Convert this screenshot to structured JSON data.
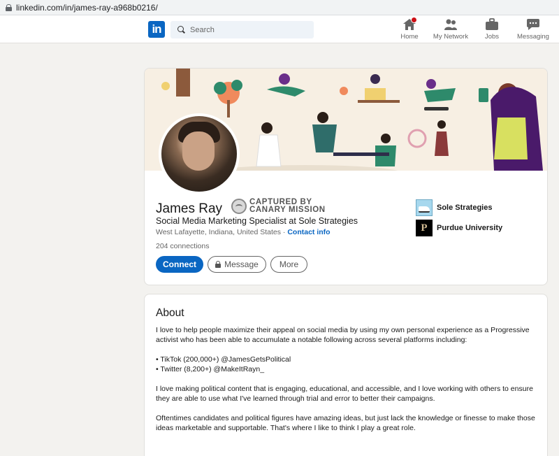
{
  "browser": {
    "url": "linkedin.com/in/james-ray-a968b0216/"
  },
  "nav": {
    "logo": "in",
    "search_placeholder": "Search",
    "items": [
      {
        "label": "Home",
        "icon": "home-icon"
      },
      {
        "label": "My Network",
        "icon": "network-icon"
      },
      {
        "label": "Jobs",
        "icon": "briefcase-icon"
      },
      {
        "label": "Messaging",
        "icon": "messaging-icon"
      }
    ]
  },
  "profile": {
    "name": "James Ray",
    "capture_line1": "CAPTURED BY",
    "capture_line2": "CANARY MISSION",
    "headline": "Social Media Marketing Specialist at Sole Strategies",
    "location": "West Lafayette, Indiana, United States",
    "separator": "·",
    "contact_info": "Contact info",
    "connections": "204 connections",
    "buttons": {
      "connect": "Connect",
      "message": "Message",
      "more": "More"
    },
    "companies": [
      {
        "name": "Sole Strategies"
      },
      {
        "name": "Purdue University"
      }
    ]
  },
  "about": {
    "title": "About",
    "p1": "I love to help people maximize their appeal on social media by using my own personal experience as a Progressive activist who has been able to accumulate a notable following across several platforms including:",
    "bullet1": "• TikTok (200,000+) @JamesGetsPolitical",
    "bullet2": "• Twitter (8,200+) @MakeItRayn_",
    "p2": "I love making political content that is engaging, educational, and accessible, and I love working with others to ensure they are able to use what I've learned through trial and error to better their campaigns.",
    "p3": "Oftentimes candidates and political figures have amazing ideas, but just lack the knowledge or finesse to make those ideas marketable and supportable. That's where I like to think I play a great role."
  },
  "colors": {
    "brand": "#0a66c2",
    "page_bg": "#f3f2ef",
    "badge": "#cc1016"
  }
}
